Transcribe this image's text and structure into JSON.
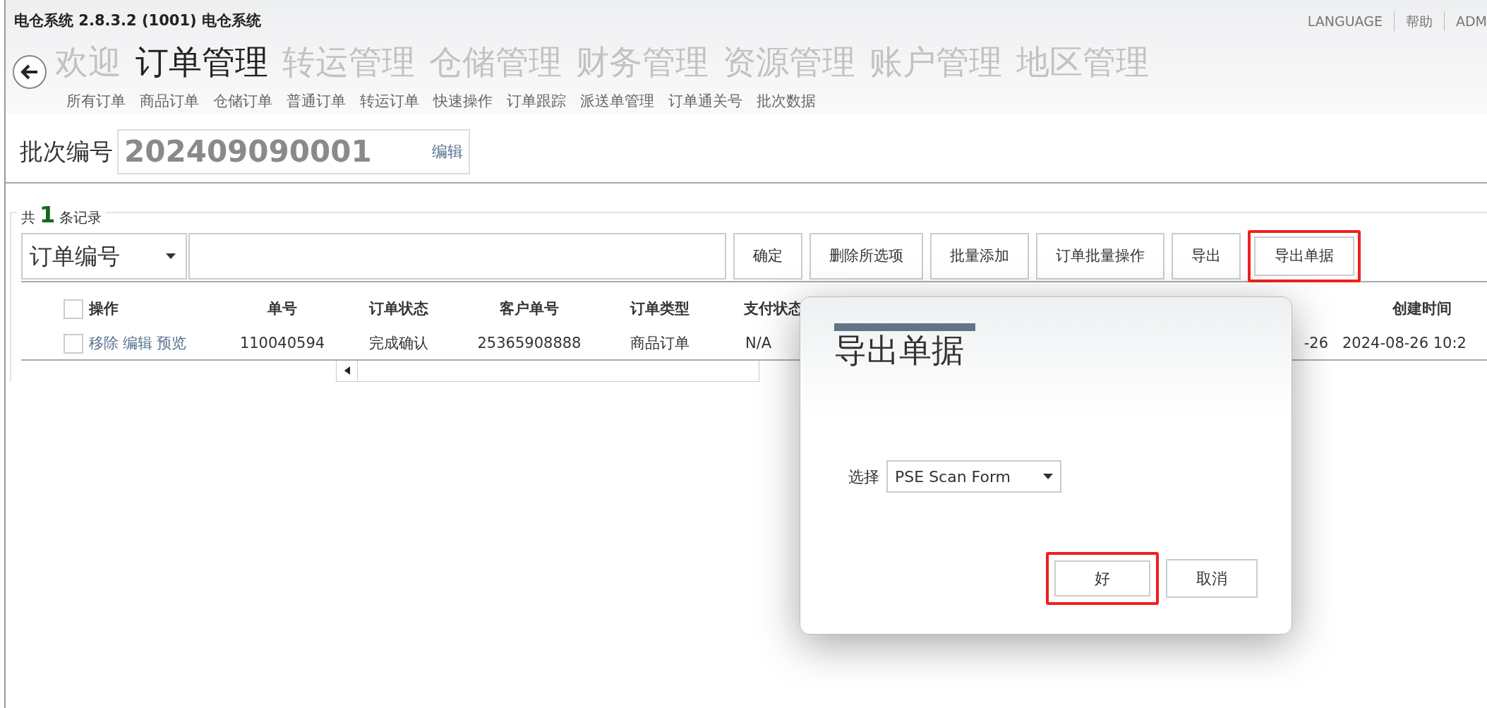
{
  "window": {
    "title": "电仓系统 2.8.3.2 (1001) 电仓系统"
  },
  "top_links": [
    "LANGUAGE",
    "帮助",
    "ADM"
  ],
  "main_nav": [
    {
      "label": "欢迎",
      "selected": false
    },
    {
      "label": "订单管理",
      "selected": true
    },
    {
      "label": "转运管理",
      "selected": false
    },
    {
      "label": "仓储管理",
      "selected": false
    },
    {
      "label": "财务管理",
      "selected": false
    },
    {
      "label": "资源管理",
      "selected": false
    },
    {
      "label": "账户管理",
      "selected": false
    },
    {
      "label": "地区管理",
      "selected": false
    }
  ],
  "sub_nav": [
    "所有订单",
    "商品订单",
    "仓储订单",
    "普通订单",
    "转运订单",
    "快速操作",
    "订单跟踪",
    "派送单管理",
    "订单通关号",
    "批次数据"
  ],
  "batch": {
    "label": "批次编号",
    "value": "202409090001",
    "edit_link": "编辑"
  },
  "records": {
    "prefix": "共",
    "count": "1",
    "suffix": "条记录"
  },
  "search": {
    "field_select": "订单编号"
  },
  "toolbar_buttons": [
    {
      "label": "确定",
      "highlighted": false
    },
    {
      "label": "删除所选项",
      "highlighted": false
    },
    {
      "label": "批量添加",
      "highlighted": false
    },
    {
      "label": "订单批量操作",
      "highlighted": false
    },
    {
      "label": "导出",
      "highlighted": false
    },
    {
      "label": "导出单据",
      "highlighted": true
    }
  ],
  "table": {
    "header_checked": false,
    "columns": [
      {
        "label": "操作"
      },
      {
        "label": "单号"
      },
      {
        "label": "订单状态"
      },
      {
        "label": "客户单号"
      },
      {
        "label": "订单类型"
      },
      {
        "label": "支付状态"
      },
      {},
      {
        "label": "创建时间"
      }
    ],
    "rows": [
      {
        "checked": false,
        "cells": [
          [
            "移除",
            "编辑",
            "预览"
          ],
          "110040594",
          "完成确认",
          "25365908888",
          "商品订单",
          "N/A",
          "-26",
          "2024-08-26 10:2"
        ]
      }
    ]
  },
  "dialog": {
    "title": "导出单据",
    "select_label": "选择",
    "select_value": "PSE Scan Form",
    "buttons": [
      {
        "label": "好",
        "highlighted": true
      },
      {
        "label": "取消",
        "highlighted": false
      }
    ]
  }
}
